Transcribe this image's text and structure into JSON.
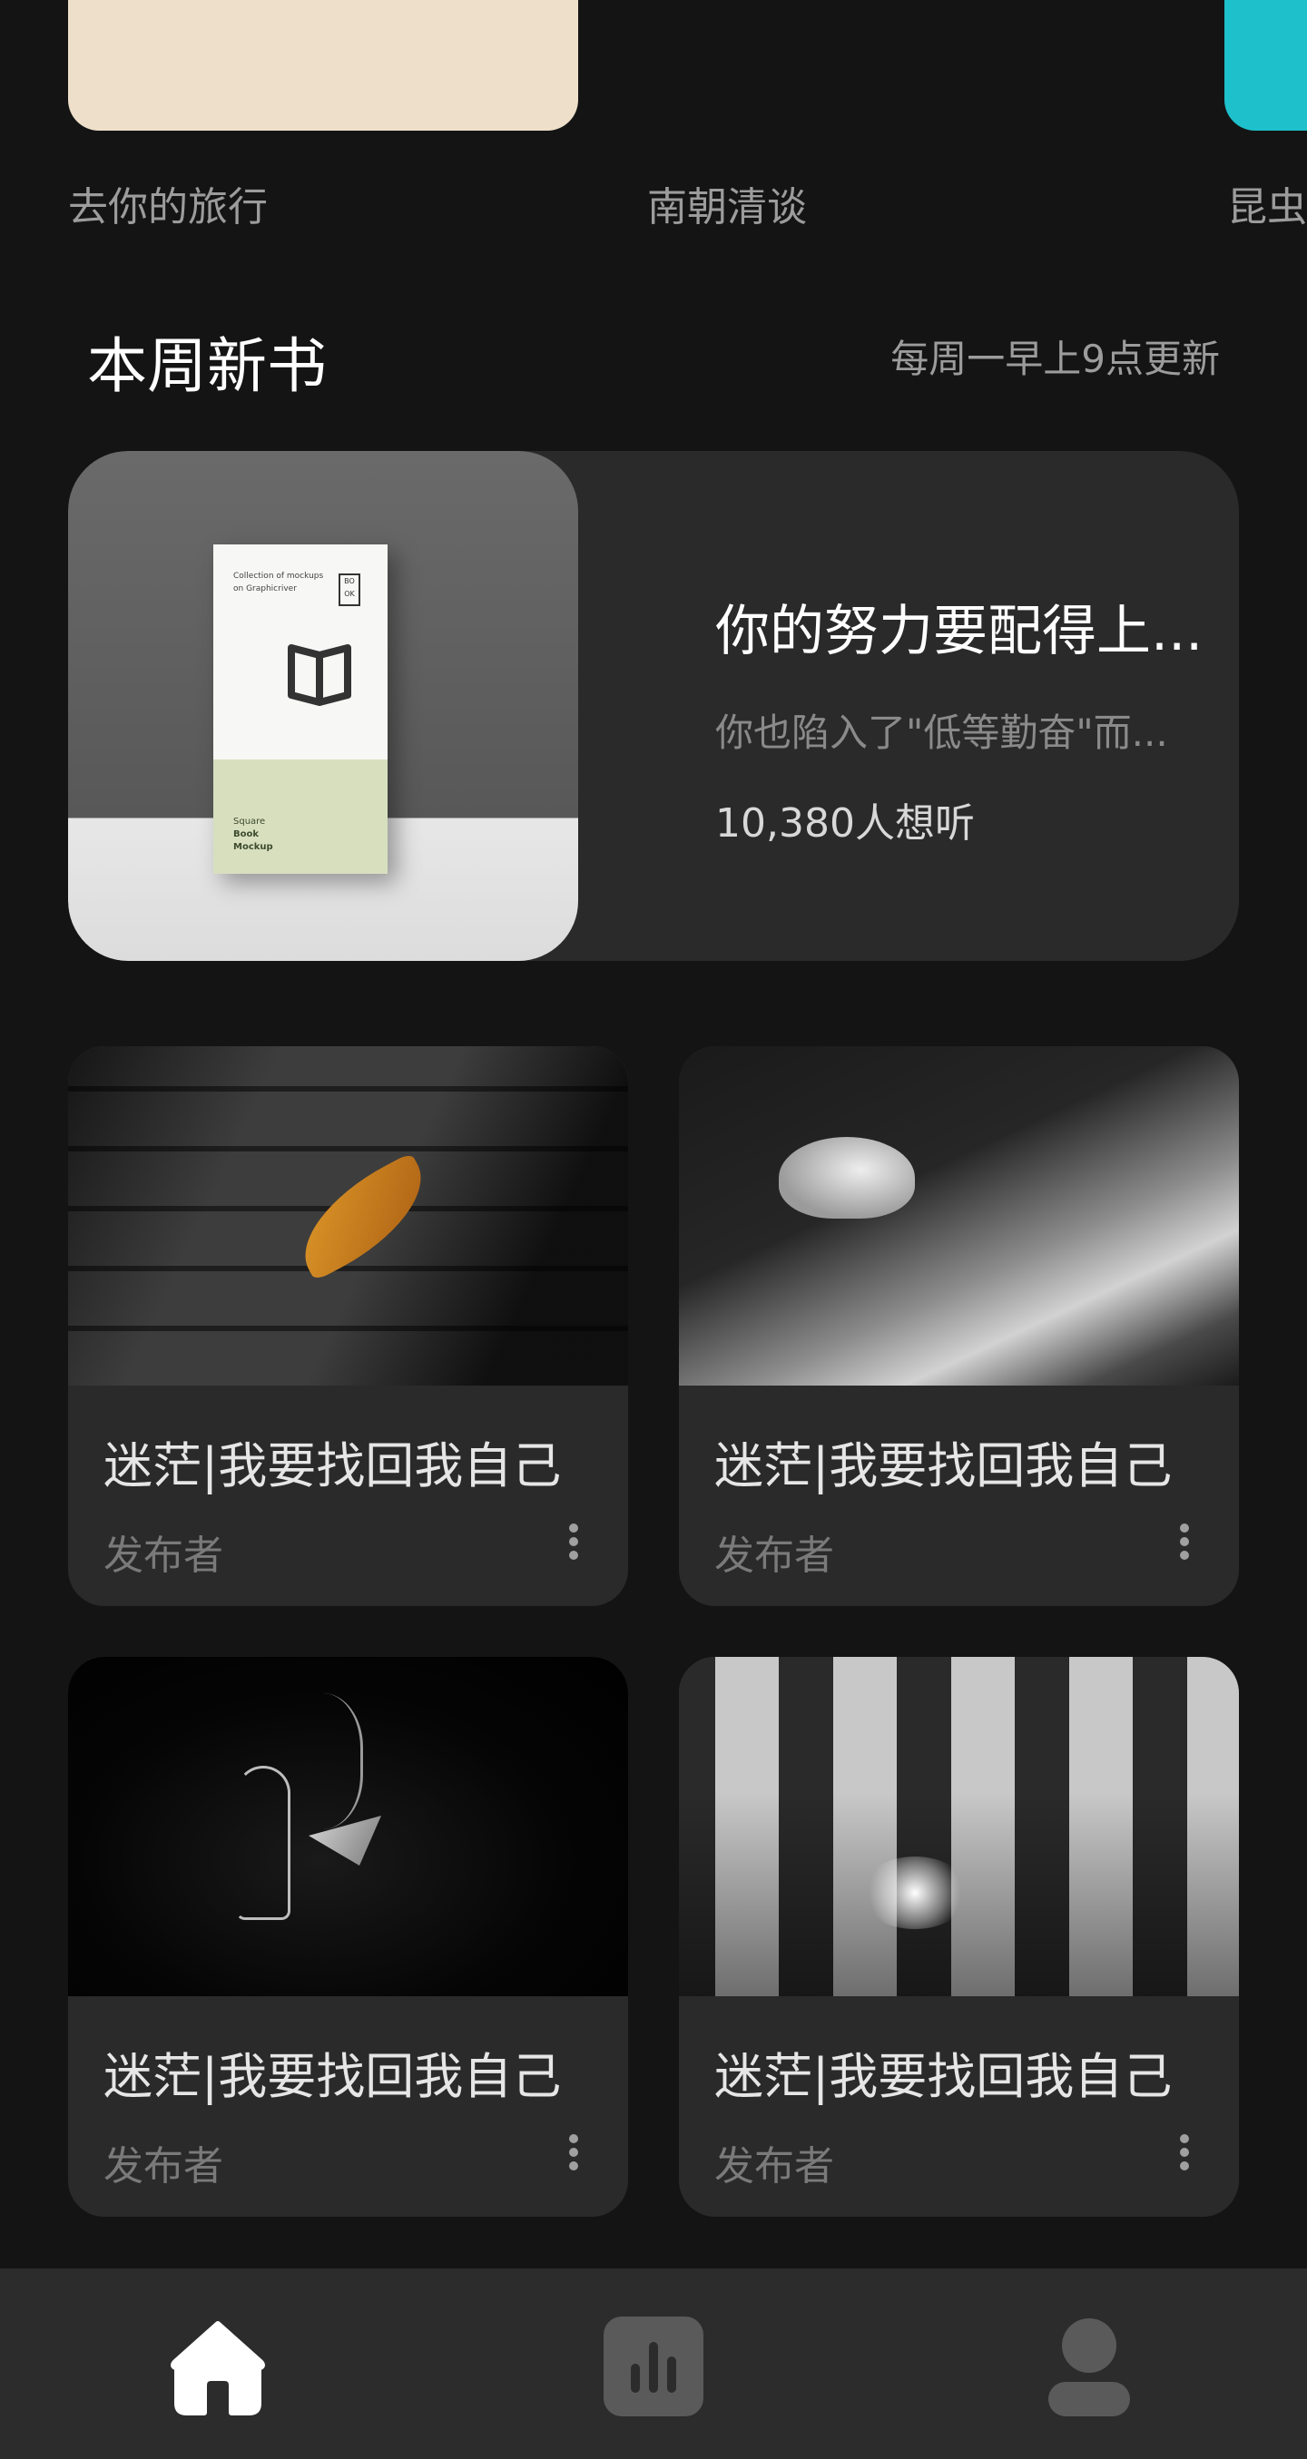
{
  "carousel": {
    "items": [
      {
        "label": "去你的旅行",
        "color": "#eedfca"
      },
      {
        "label": "南朝清谈",
        "color": null
      },
      {
        "label": "昆虫",
        "color": "#1ec1cb"
      }
    ]
  },
  "section": {
    "title": "本周新书",
    "note": "每周一早上9点更新"
  },
  "featured": {
    "title": "你的努力要配得上...",
    "description": "你也陷入了\"低等勤奋\"而...",
    "listeners": "10,380人想听",
    "cover": {
      "top_line1": "Collection of mockups",
      "top_line2": "on Graphicriver",
      "box_text": "BO OK",
      "bottom_line1": "Square",
      "bottom_line2": "Book",
      "bottom_line3": "Mockup"
    }
  },
  "grid": {
    "items": [
      {
        "title": "迷茫|我要找回我自己",
        "author": "发布者",
        "image": "leaf-on-bricks"
      },
      {
        "title": "迷茫|我要找回我自己",
        "author": "发布者",
        "image": "cat-in-sunlight"
      },
      {
        "title": "迷茫|我要找回我自己",
        "author": "发布者",
        "image": "praying-silhouette"
      },
      {
        "title": "迷茫|我要找回我自己",
        "author": "发布者",
        "image": "sunlit-windows"
      }
    ]
  },
  "nav": {
    "items": [
      {
        "icon": "home-icon",
        "active": true
      },
      {
        "icon": "bar-chart-icon",
        "active": false
      },
      {
        "icon": "user-icon",
        "active": false
      }
    ]
  },
  "colors": {
    "background": "#141414",
    "card": "#2a2a2a",
    "nav": "#2c2c2c",
    "text_primary": "#ffffff",
    "text_secondary": "#9c9c9c"
  }
}
